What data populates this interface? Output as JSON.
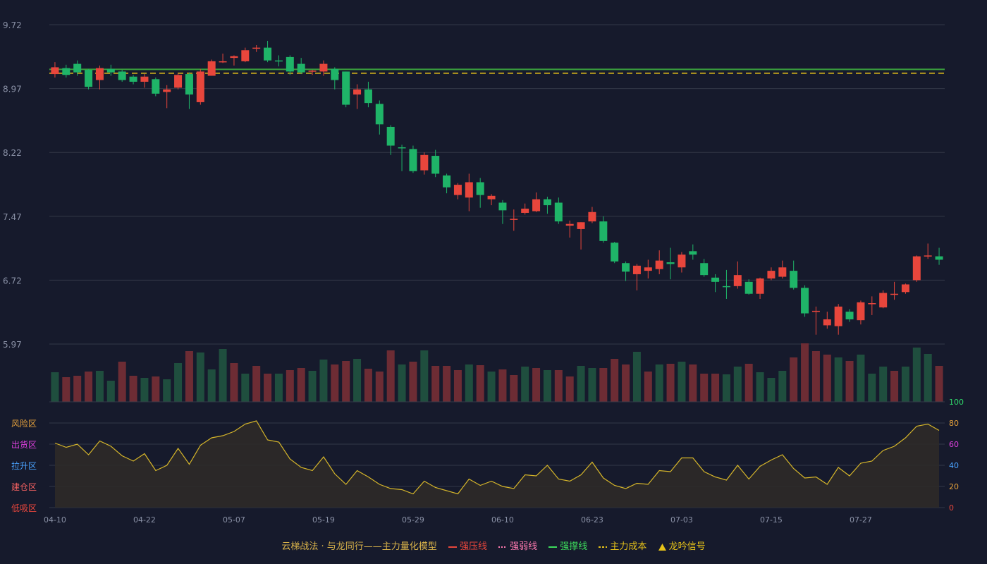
{
  "chart_data": {
    "type": "candlestick",
    "x_tick_labels": [
      "04-10",
      "04-22",
      "05-07",
      "05-19",
      "05-29",
      "06-10",
      "06-23",
      "07-03",
      "07-15",
      "07-27"
    ],
    "y_ticks": [
      "9.72",
      "8.97",
      "8.22",
      "7.47",
      "6.72",
      "5.97"
    ],
    "y_range": [
      5.97,
      9.72
    ],
    "reference_lines": {
      "strong_support": 9.195,
      "main_cost": 9.15
    },
    "candles": [
      [
        9.14,
        9.22,
        9.28,
        9.1
      ],
      [
        9.21,
        9.13,
        9.25,
        9.1
      ],
      [
        9.26,
        9.16,
        9.3,
        9.12
      ],
      [
        9.19,
        8.99,
        9.2,
        8.96
      ],
      [
        9.07,
        9.21,
        9.24,
        8.96
      ],
      [
        9.2,
        9.16,
        9.25,
        9.12
      ],
      [
        9.17,
        9.07,
        9.19,
        9.05
      ],
      [
        9.11,
        9.05,
        9.13,
        9.02
      ],
      [
        9.05,
        9.11,
        9.14,
        8.98
      ],
      [
        9.08,
        8.91,
        9.1,
        8.88
      ],
      [
        8.93,
        8.96,
        9.01,
        8.74
      ],
      [
        8.98,
        9.13,
        9.15,
        8.96
      ],
      [
        9.14,
        8.9,
        9.16,
        8.73
      ],
      [
        8.81,
        9.17,
        9.2,
        8.78
      ],
      [
        9.12,
        9.29,
        9.31,
        9.12
      ],
      [
        9.28,
        9.29,
        9.38,
        9.27
      ],
      [
        9.33,
        9.35,
        9.36,
        9.24
      ],
      [
        9.29,
        9.42,
        9.45,
        9.28
      ],
      [
        9.45,
        9.45,
        9.48,
        9.4
      ],
      [
        9.45,
        9.3,
        9.53,
        9.28
      ],
      [
        9.3,
        9.29,
        9.36,
        9.23
      ],
      [
        9.34,
        9.17,
        9.36,
        9.13
      ],
      [
        9.26,
        9.16,
        9.33,
        9.14
      ],
      [
        9.17,
        9.18,
        9.19,
        9.13
      ],
      [
        9.17,
        9.26,
        9.3,
        9.12
      ],
      [
        9.2,
        9.07,
        9.22,
        8.96
      ],
      [
        9.17,
        8.78,
        9.17,
        8.75
      ],
      [
        8.9,
        8.96,
        9.02,
        8.73
      ],
      [
        8.96,
        8.8,
        9.05,
        8.75
      ],
      [
        8.79,
        8.55,
        8.83,
        8.43
      ],
      [
        8.52,
        8.3,
        8.54,
        8.19
      ],
      [
        8.28,
        8.27,
        8.31,
        8.0
      ],
      [
        8.26,
        8.0,
        8.3,
        7.98
      ],
      [
        8.01,
        8.19,
        8.22,
        7.96
      ],
      [
        8.18,
        7.97,
        8.25,
        7.93
      ],
      [
        7.95,
        7.81,
        7.97,
        7.74
      ],
      [
        7.72,
        7.84,
        7.86,
        7.67
      ],
      [
        7.69,
        7.87,
        7.97,
        7.53
      ],
      [
        7.87,
        7.72,
        7.92,
        7.57
      ],
      [
        7.67,
        7.71,
        7.73,
        7.6
      ],
      [
        7.63,
        7.54,
        7.66,
        7.38
      ],
      [
        7.43,
        7.44,
        7.55,
        7.3
      ],
      [
        7.51,
        7.56,
        7.62,
        7.49
      ],
      [
        7.53,
        7.67,
        7.75,
        7.52
      ],
      [
        7.67,
        7.6,
        7.7,
        7.5
      ],
      [
        7.63,
        7.41,
        7.69,
        7.38
      ],
      [
        7.36,
        7.38,
        7.42,
        7.22
      ],
      [
        7.32,
        7.4,
        7.4,
        7.08
      ],
      [
        7.41,
        7.52,
        7.58,
        7.39
      ],
      [
        7.41,
        7.18,
        7.47,
        7.16
      ],
      [
        7.16,
        6.94,
        7.17,
        6.92
      ],
      [
        6.92,
        6.82,
        6.94,
        6.71
      ],
      [
        6.79,
        6.89,
        6.91,
        6.6
      ],
      [
        6.83,
        6.87,
        6.96,
        6.74
      ],
      [
        6.85,
        6.95,
        7.07,
        6.79
      ],
      [
        6.93,
        6.91,
        7.1,
        6.73
      ],
      [
        6.87,
        7.02,
        7.05,
        6.81
      ],
      [
        7.06,
        7.02,
        7.14,
        6.96
      ],
      [
        6.92,
        6.78,
        6.97,
        6.76
      ],
      [
        6.75,
        6.7,
        6.79,
        6.58
      ],
      [
        6.65,
        6.64,
        6.84,
        6.5
      ],
      [
        6.65,
        6.78,
        6.94,
        6.62
      ],
      [
        6.7,
        6.56,
        6.73,
        6.55
      ],
      [
        6.56,
        6.74,
        6.75,
        6.5
      ],
      [
        6.74,
        6.83,
        6.87,
        6.72
      ],
      [
        6.76,
        6.87,
        6.95,
        6.74
      ],
      [
        6.83,
        6.63,
        6.95,
        6.61
      ],
      [
        6.63,
        6.33,
        6.66,
        6.29
      ],
      [
        6.36,
        6.36,
        6.41,
        6.08
      ],
      [
        6.19,
        6.26,
        6.35,
        6.15
      ],
      [
        6.18,
        6.41,
        6.44,
        6.08
      ],
      [
        6.35,
        6.26,
        6.38,
        6.23
      ],
      [
        6.25,
        6.46,
        6.48,
        6.2
      ],
      [
        6.44,
        6.45,
        6.53,
        6.31
      ],
      [
        6.4,
        6.57,
        6.6,
        6.39
      ],
      [
        6.55,
        6.56,
        6.7,
        6.49
      ],
      [
        6.58,
        6.67,
        6.68,
        6.56
      ],
      [
        6.72,
        7.0,
        7.01,
        6.7
      ],
      [
        7.0,
        7.01,
        7.15,
        6.97
      ],
      [
        7.0,
        6.96,
        7.1,
        6.9
      ]
    ],
    "volume": [
      [
        42,
        "d"
      ],
      [
        35,
        "r"
      ],
      [
        37,
        "r"
      ],
      [
        43,
        "r"
      ],
      [
        44,
        "d"
      ],
      [
        30,
        "d"
      ],
      [
        57,
        "r"
      ],
      [
        37,
        "r"
      ],
      [
        34,
        "d"
      ],
      [
        36,
        "r"
      ],
      [
        32,
        "d"
      ],
      [
        55,
        "d"
      ],
      [
        72,
        "r"
      ],
      [
        70,
        "d"
      ],
      [
        46,
        "d"
      ],
      [
        75,
        "d"
      ],
      [
        55,
        "r"
      ],
      [
        40,
        "d"
      ],
      [
        51,
        "r"
      ],
      [
        40,
        "r"
      ],
      [
        40,
        "d"
      ],
      [
        45,
        "r"
      ],
      [
        48,
        "r"
      ],
      [
        44,
        "d"
      ],
      [
        60,
        "d"
      ],
      [
        53,
        "r"
      ],
      [
        58,
        "r"
      ],
      [
        61,
        "d"
      ],
      [
        47,
        "r"
      ],
      [
        43,
        "r"
      ],
      [
        73,
        "r"
      ],
      [
        53,
        "d"
      ],
      [
        57,
        "r"
      ],
      [
        73,
        "d"
      ],
      [
        51,
        "r"
      ],
      [
        51,
        "r"
      ],
      [
        45,
        "r"
      ],
      [
        53,
        "d"
      ],
      [
        52,
        "r"
      ],
      [
        43,
        "d"
      ],
      [
        46,
        "r"
      ],
      [
        38,
        "r"
      ],
      [
        50,
        "d"
      ],
      [
        48,
        "r"
      ],
      [
        45,
        "d"
      ],
      [
        45,
        "r"
      ],
      [
        36,
        "r"
      ],
      [
        51,
        "d"
      ],
      [
        48,
        "d"
      ],
      [
        48,
        "r"
      ],
      [
        61,
        "r"
      ],
      [
        53,
        "r"
      ],
      [
        71,
        "d"
      ],
      [
        43,
        "r"
      ],
      [
        53,
        "d"
      ],
      [
        54,
        "r"
      ],
      [
        57,
        "d"
      ],
      [
        53,
        "r"
      ],
      [
        40,
        "r"
      ],
      [
        40,
        "r"
      ],
      [
        39,
        "d"
      ],
      [
        50,
        "d"
      ],
      [
        54,
        "r"
      ],
      [
        42,
        "d"
      ],
      [
        34,
        "d"
      ],
      [
        44,
        "d"
      ],
      [
        63,
        "r"
      ],
      [
        83,
        "r"
      ],
      [
        72,
        "r"
      ],
      [
        67,
        "r"
      ],
      [
        63,
        "d"
      ],
      [
        58,
        "r"
      ],
      [
        67,
        "d"
      ],
      [
        40,
        "d"
      ],
      [
        50,
        "d"
      ],
      [
        44,
        "r"
      ],
      [
        50,
        "d"
      ],
      [
        77,
        "d"
      ],
      [
        68,
        "d"
      ],
      [
        51,
        "r"
      ]
    ],
    "risk_index": {
      "y_ticks": [
        "100",
        "80",
        "60",
        "40",
        "20",
        "0"
      ],
      "zone_labels": [
        "风险区",
        "出货区",
        "拉升区",
        "建仓区",
        "低吸区"
      ],
      "values": [
        61,
        57,
        60,
        50,
        63,
        58,
        49,
        44,
        51,
        35,
        40,
        56,
        41,
        59,
        66,
        68,
        72,
        79,
        82,
        64,
        62,
        46,
        38,
        35,
        48,
        32,
        22,
        35,
        29,
        22,
        18,
        17,
        13,
        25,
        19,
        16,
        13,
        27,
        21,
        25,
        20,
        18,
        31,
        30,
        40,
        27,
        25,
        31,
        43,
        28,
        21,
        18,
        23,
        22,
        35,
        34,
        47,
        47,
        34,
        29,
        26,
        40,
        27,
        39,
        45,
        50,
        37,
        28,
        29,
        22,
        38,
        30,
        42,
        44,
        54,
        58,
        66,
        77,
        79,
        73
      ]
    },
    "legend": {
      "title": "云梯战法 · 与龙同行——主力量化模型",
      "items": [
        "强压线",
        "强弱线",
        "强撑线",
        "主力成本",
        "龙吟信号"
      ]
    },
    "colors": {
      "background": "#161a2c",
      "up": "#e8463c",
      "down": "#1fb468",
      "volume_up": "#6d2c34",
      "volume_down": "#1f4e3e",
      "grid": "#333847",
      "tick_text": "#8b92a7",
      "support_line": "#3aa03e",
      "cost_line": "#e6c219",
      "risk_line": "#d6b62a",
      "risk_fill": "#2e2a28",
      "risk_axis_colors": [
        "#2fd76a",
        "#e6a23c",
        "#e040e0",
        "#4aa3ff",
        "#e6a23c",
        "#e8463c"
      ],
      "zone_label_colors": [
        "#e6a23c",
        "#e040e0",
        "#4aa3ff",
        "#f06060",
        "#e8463c"
      ],
      "legend_symbol_colors": [
        "#e8463c",
        "#ff7ab0",
        "#3ddc5c",
        "#e6c219",
        "#e6c219"
      ]
    }
  }
}
